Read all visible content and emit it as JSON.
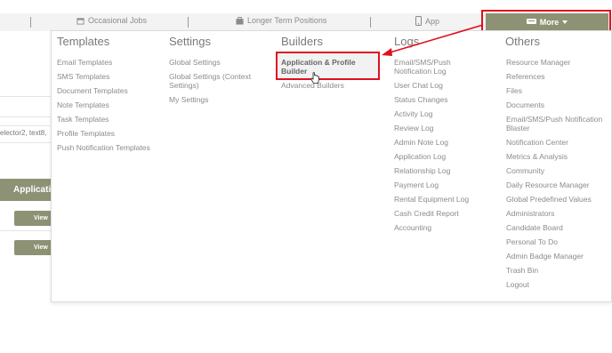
{
  "nav": {
    "items": [
      {
        "label": "Occasional Jobs",
        "icon": "calendar-icon"
      },
      {
        "label": "Longer Term Positions",
        "icon": "briefcase-icon"
      },
      {
        "label": "App",
        "icon": "mobile-icon"
      }
    ],
    "more_label": "More"
  },
  "background": {
    "fragment_text": "elector2, text8,",
    "table_header": "Applicatio",
    "view_label": "View"
  },
  "menu": {
    "templates": {
      "title": "Templates",
      "items": [
        "Email Templates",
        "SMS Templates",
        "Document Templates",
        "Note Templates",
        "Task Templates",
        "Profile Templates",
        "Push Notification Templates"
      ]
    },
    "settings": {
      "title": "Settings",
      "items": [
        "Global Settings",
        "Global Settings (Context Settings)",
        "My Settings"
      ]
    },
    "builders": {
      "title": "Builders",
      "items": [
        "Application & Profile Builder",
        "Advanced Builders"
      ]
    },
    "logs": {
      "title": "Logs",
      "items": [
        "Email/SMS/Push Notification Log",
        "User Chat Log",
        "Status Changes",
        "Activity Log",
        "Review Log",
        "Admin Note Log",
        "Application Log",
        "Relationship Log",
        "Payment Log",
        "Rental Equipment Log",
        "Cash Credit Report",
        "Accounting"
      ]
    },
    "others": {
      "title": "Others",
      "items": [
        "Resource Manager",
        "References",
        "Files",
        "Documents",
        "Email/SMS/Push Notification Blaster",
        "Notification Center",
        "Metrics & Analysis",
        "Community",
        "Daily Resource Manager",
        "Global Predefined Values",
        "Administrators",
        "Candidate Board",
        "Personal To Do",
        "Admin Badge Manager",
        "Trash Bin",
        "Logout"
      ]
    }
  },
  "colors": {
    "accent": "#8d9274",
    "highlight": "#e0101e"
  }
}
